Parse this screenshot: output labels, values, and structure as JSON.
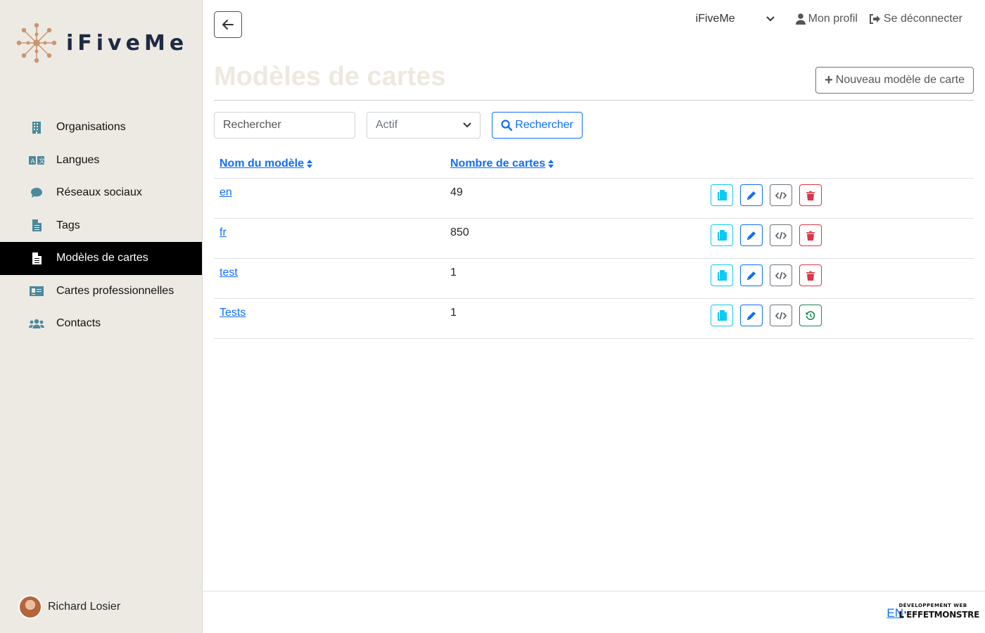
{
  "brand": {
    "name": "iFiveMe"
  },
  "sidebar": {
    "items": [
      {
        "label": "Organisations",
        "icon": "building-icon"
      },
      {
        "label": "Langues",
        "icon": "language-icon"
      },
      {
        "label": "Réseaux sociaux",
        "icon": "comment-icon"
      },
      {
        "label": "Tags",
        "icon": "file-icon"
      },
      {
        "label": "Modèles de cartes",
        "icon": "file-icon",
        "active": true
      },
      {
        "label": "Cartes professionnelles",
        "icon": "id-card-icon"
      },
      {
        "label": "Contacts",
        "icon": "users-icon"
      }
    ],
    "user_name": "Richard Losier"
  },
  "topnav": {
    "org_selected": "iFiveMe",
    "profile_label": "Mon profil",
    "logout_label": "Se déconnecter"
  },
  "page": {
    "title": "Modèles de cartes",
    "new_button_label": "Nouveau modèle de carte"
  },
  "search": {
    "placeholder": "Rechercher",
    "status_selected": "Actif",
    "button_label": "Rechercher"
  },
  "table": {
    "headers": [
      "Nom du modèle",
      "Nombre de cartes"
    ],
    "rows": [
      {
        "name": "en",
        "count": "49",
        "last_action": "delete"
      },
      {
        "name": "fr",
        "count": "850",
        "last_action": "delete"
      },
      {
        "name": "test",
        "count": "1",
        "last_action": "delete"
      },
      {
        "name": "Tests",
        "count": "1",
        "last_action": "restore"
      }
    ]
  },
  "footer": {
    "lang_link": "EN",
    "credit_small": "DÉVELOPPEMENT WEB",
    "credit_big": "L'EFFETMONSTRE"
  },
  "colors": {
    "sidebar_bg": "#edeae3",
    "primary": "#0d6efd",
    "info": "#0dcaf0",
    "danger": "#dc3545",
    "success": "#198754",
    "logo_accent": "#c9956f"
  }
}
